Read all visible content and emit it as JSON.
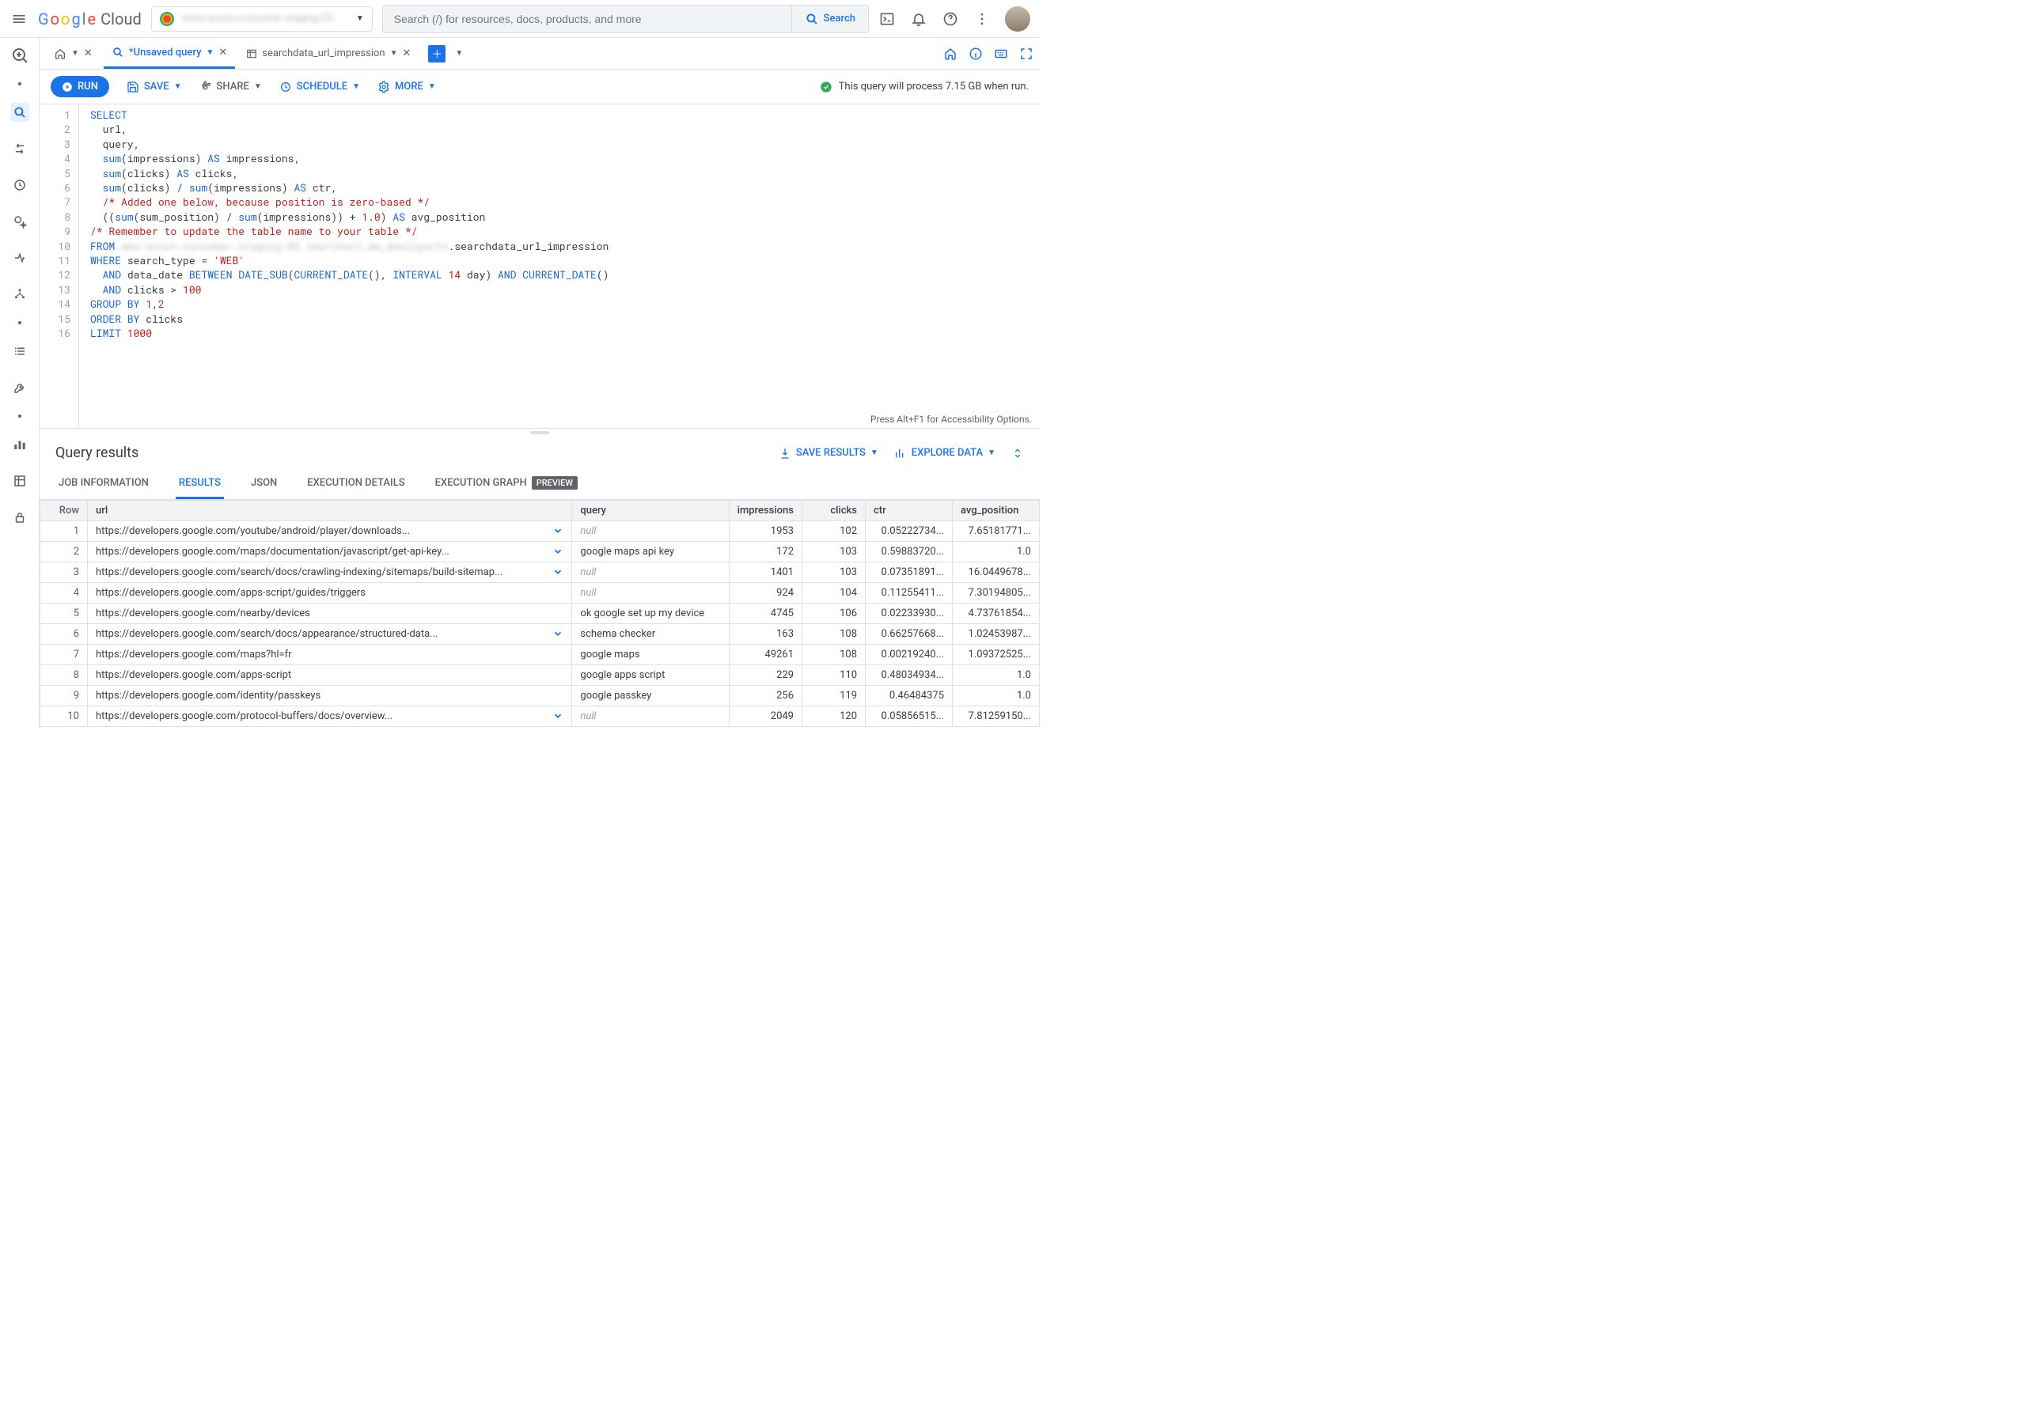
{
  "header": {
    "logo_text": "Google Cloud",
    "project_name_blurred": "write-scout-consumer-staging-05",
    "search_placeholder": "Search (/) for resources, docs, products, and more",
    "search_button": "Search"
  },
  "tabs": {
    "unsaved": "*Unsaved query",
    "table_tab": "searchdata_url_impression"
  },
  "toolbar": {
    "run": "RUN",
    "save": "SAVE",
    "share": "SHARE",
    "schedule": "SCHEDULE",
    "more": "MORE",
    "status": "This query will process 7.15 GB when run."
  },
  "editor": {
    "footer": "Press Alt+F1 for Accessibility Options.",
    "lines": [
      1,
      2,
      3,
      4,
      5,
      6,
      7,
      8,
      9,
      10,
      11,
      12,
      13,
      14,
      15,
      16
    ],
    "blurred_table": "wms-scout-consumer-staging-05.searchact_am_dwelcparts"
  },
  "results": {
    "title": "Query results",
    "save_results": "SAVE RESULTS",
    "explore_data": "EXPLORE DATA",
    "tabs": {
      "job_info": "JOB INFORMATION",
      "results": "RESULTS",
      "json": "JSON",
      "exec_details": "EXECUTION DETAILS",
      "exec_graph": "EXECUTION GRAPH",
      "preview_badge": "PREVIEW"
    },
    "columns": [
      "Row",
      "url",
      "query",
      "impressions",
      "clicks",
      "ctr",
      "avg_position"
    ],
    "rows": [
      {
        "row": 1,
        "url": "https://developers.google.com/youtube/android/player/downloads...",
        "chev": true,
        "query": null,
        "impressions": 1953,
        "clicks": 102,
        "ctr": "0.05222734...",
        "avg": "7.65181771..."
      },
      {
        "row": 2,
        "url": "https://developers.google.com/maps/documentation/javascript/get-api-key...",
        "chev": true,
        "query": "google maps api key",
        "impressions": 172,
        "clicks": 103,
        "ctr": "0.59883720...",
        "avg": "1.0"
      },
      {
        "row": 3,
        "url": "https://developers.google.com/search/docs/crawling-indexing/sitemaps/build-sitemap...",
        "chev": true,
        "query": null,
        "impressions": 1401,
        "clicks": 103,
        "ctr": "0.07351891...",
        "avg": "16.0449678..."
      },
      {
        "row": 4,
        "url": "https://developers.google.com/apps-script/guides/triggers",
        "chev": false,
        "query": null,
        "impressions": 924,
        "clicks": 104,
        "ctr": "0.11255411...",
        "avg": "7.30194805..."
      },
      {
        "row": 5,
        "url": "https://developers.google.com/nearby/devices",
        "chev": false,
        "query": "ok google set up my device",
        "impressions": 4745,
        "clicks": 106,
        "ctr": "0.02233930...",
        "avg": "4.73761854..."
      },
      {
        "row": 6,
        "url": "https://developers.google.com/search/docs/appearance/structured-data...",
        "chev": true,
        "query": "schema checker",
        "impressions": 163,
        "clicks": 108,
        "ctr": "0.66257668...",
        "avg": "1.02453987..."
      },
      {
        "row": 7,
        "url": "https://developers.google.com/maps?hl=fr",
        "chev": false,
        "query": "google maps",
        "impressions": 49261,
        "clicks": 108,
        "ctr": "0.00219240...",
        "avg": "1.09372525..."
      },
      {
        "row": 8,
        "url": "https://developers.google.com/apps-script",
        "chev": false,
        "query": "google apps script",
        "impressions": 229,
        "clicks": 110,
        "ctr": "0.48034934...",
        "avg": "1.0"
      },
      {
        "row": 9,
        "url": "https://developers.google.com/identity/passkeys",
        "chev": false,
        "query": "google passkey",
        "impressions": 256,
        "clicks": 119,
        "ctr": "0.46484375",
        "avg": "1.0"
      },
      {
        "row": 10,
        "url": "https://developers.google.com/protocol-buffers/docs/overview...",
        "chev": true,
        "query": null,
        "impressions": 2049,
        "clicks": 120,
        "ctr": "0.05856515...",
        "avg": "7.81259150..."
      }
    ]
  }
}
